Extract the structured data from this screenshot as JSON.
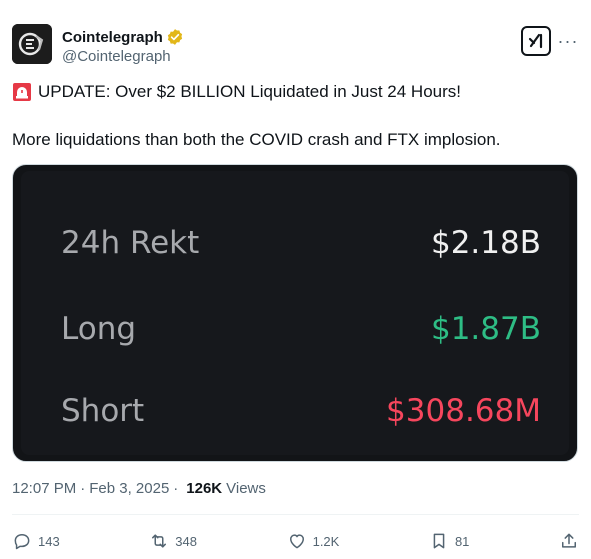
{
  "account": {
    "display_name": "Cointelegraph",
    "handle": "@Cointelegraph",
    "verified": true,
    "badge_color": "#e2b719"
  },
  "header": {
    "grok_icon": "grok-icon",
    "more_icon": "more-icon",
    "more_label": "···"
  },
  "tweet": {
    "line1": "UPDATE: Over $2 BILLION Liquidated in Just 24 Hours!",
    "line2": "More liquidations than both the COVID crash and FTX implosion."
  },
  "media": {
    "stats": [
      {
        "label": "24h Rekt",
        "value": "$2.18B",
        "color": "#f0f0f0"
      },
      {
        "label": "Long",
        "value": "$1.87B",
        "color": "#2ebd85"
      },
      {
        "label": "Short",
        "value": "$308.68M",
        "color": "#f6465d"
      }
    ]
  },
  "meta": {
    "time": "12:07 PM",
    "separator1": "·",
    "date": "Feb 3, 2025",
    "separator2": "·",
    "views_count": "126K",
    "views_label": "Views"
  },
  "actions": {
    "replies": "143",
    "reposts": "348",
    "likes": "1.2K",
    "bookmarks": "81"
  }
}
